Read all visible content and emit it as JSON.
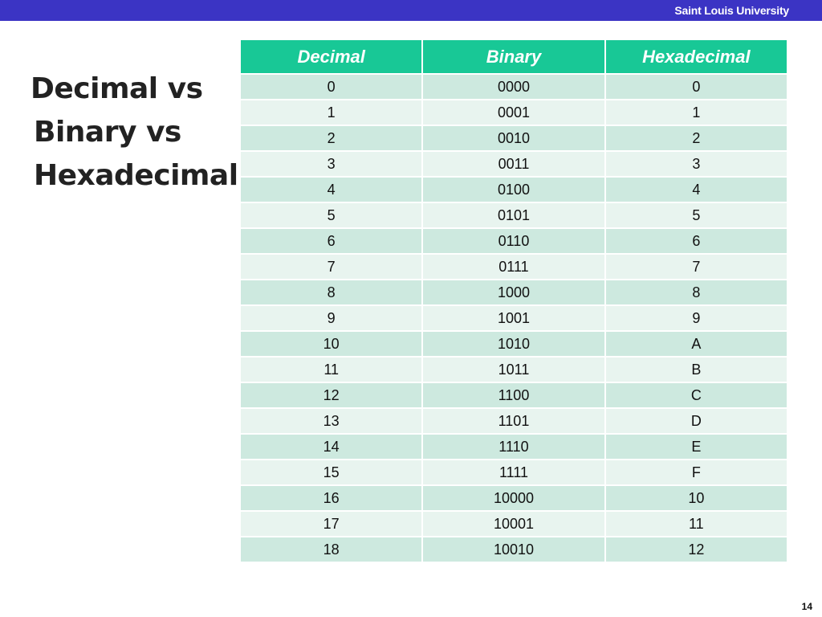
{
  "header": {
    "university": "Saint Louis University",
    "bar_color": "#3b34c4"
  },
  "title": {
    "line1": "Decimal vs",
    "line2": "Binary vs",
    "line3": "Hexadecimal"
  },
  "table": {
    "header_color": "#18c896",
    "headers": [
      "Decimal",
      "Binary",
      "Hexadecimal"
    ],
    "rows": [
      [
        "0",
        "0000",
        "0"
      ],
      [
        "1",
        "0001",
        "1"
      ],
      [
        "2",
        "0010",
        "2"
      ],
      [
        "3",
        "0011",
        "3"
      ],
      [
        "4",
        "0100",
        "4"
      ],
      [
        "5",
        "0101",
        "5"
      ],
      [
        "6",
        "0110",
        "6"
      ],
      [
        "7",
        "0111",
        "7"
      ],
      [
        "8",
        "1000",
        "8"
      ],
      [
        "9",
        "1001",
        "9"
      ],
      [
        "10",
        "1010",
        "A"
      ],
      [
        "11",
        "1011",
        "B"
      ],
      [
        "12",
        "1100",
        "C"
      ],
      [
        "13",
        "1101",
        "D"
      ],
      [
        "14",
        "1110",
        "E"
      ],
      [
        "15",
        "1111",
        "F"
      ],
      [
        "16",
        "10000",
        "10"
      ],
      [
        "17",
        "10001",
        "11"
      ],
      [
        "18",
        "10010",
        "12"
      ]
    ]
  },
  "footer": {
    "page_number": "14"
  }
}
